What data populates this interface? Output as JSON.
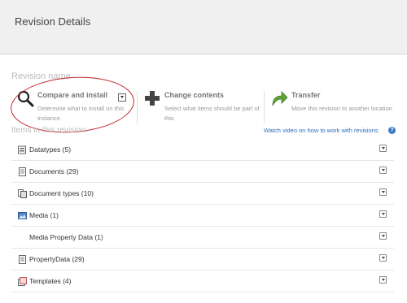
{
  "header": {
    "title": "Revision Details"
  },
  "main": {
    "revision_name_label": "Revision name",
    "actions": [
      {
        "icon": "magnifier-icon",
        "title": "Compare and install",
        "description": "Determine what to install on this instance"
      },
      {
        "icon": "plus-icon",
        "title": "Change contents",
        "description": "Select what items should be part of this"
      },
      {
        "icon": "green-arrow-icon",
        "title": "Transfer",
        "description": "Move this revision to another location"
      }
    ],
    "video_link": "Watch video on how to work with revisions",
    "help_icon": "?",
    "items_label": "Items in this revision:",
    "items": [
      {
        "label": "Datatypes (5)",
        "icon": "datatype-icon"
      },
      {
        "label": "Documents (29)",
        "icon": "document-icon"
      },
      {
        "label": "Document types (10)",
        "icon": "document-type-icon"
      },
      {
        "label": "Media (1)",
        "icon": "media-icon"
      },
      {
        "label": "Media Property Data (1)",
        "icon": ""
      },
      {
        "label": "PropertyData (29)",
        "icon": "property-data-icon"
      },
      {
        "label": "Templates (4)",
        "icon": "template-icon"
      }
    ]
  },
  "colors": {
    "link": "#2a6ebb",
    "highlight": "#c0262b",
    "plus": "#444444",
    "arrow": "#5aa33a"
  }
}
